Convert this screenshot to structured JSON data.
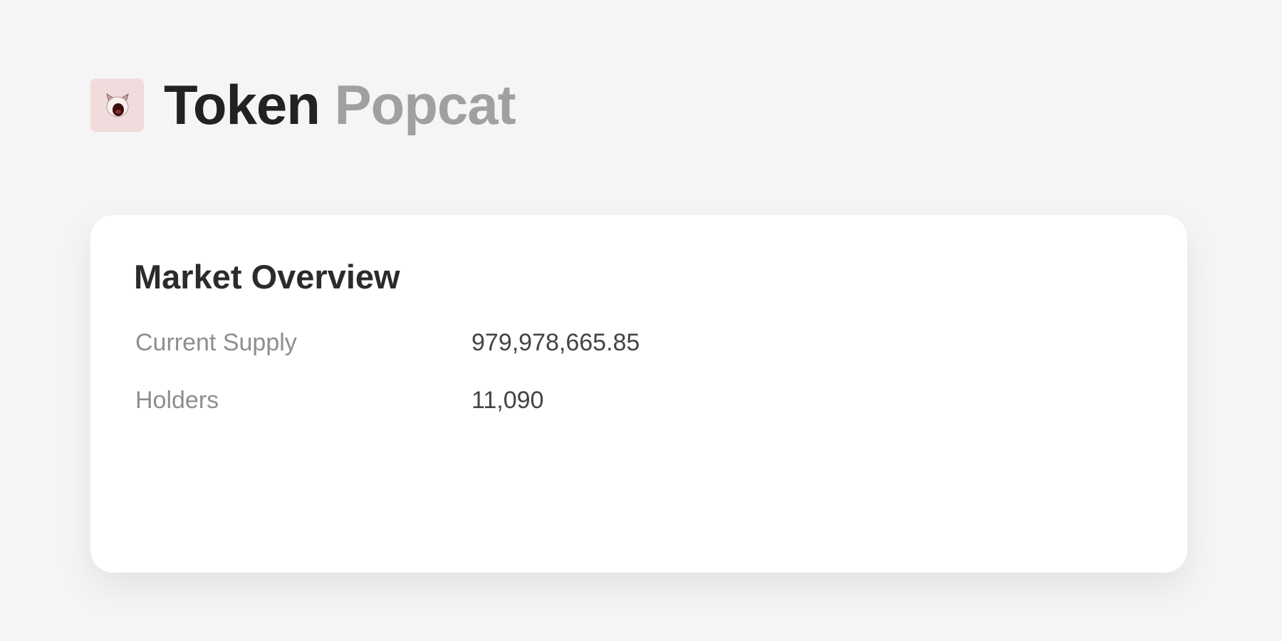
{
  "header": {
    "icon": "popcat-token-icon",
    "title_prefix": "Token",
    "title_name": "Popcat"
  },
  "market_overview": {
    "title": "Market Overview",
    "rows": [
      {
        "label": "Current Supply",
        "value": "979,978,665.85"
      },
      {
        "label": "Holders",
        "value": "11,090"
      }
    ]
  },
  "colors": {
    "background": "#f5f5f5",
    "card": "#ffffff",
    "title_primary": "#222222",
    "title_secondary": "#a0a0a0",
    "icon_bg": "#f0dcdc"
  }
}
